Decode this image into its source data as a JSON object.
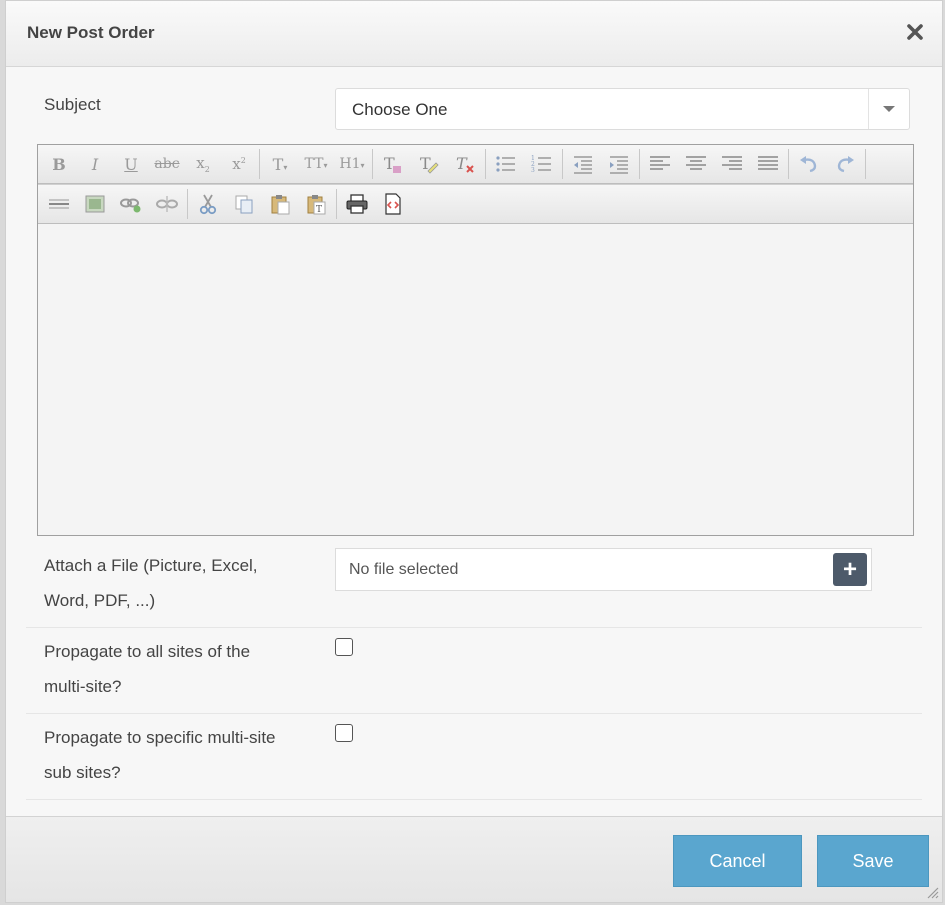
{
  "dialog": {
    "title": "New Post Order",
    "close_icon": "close-icon"
  },
  "form": {
    "subject_label": "Subject",
    "subject_value": "Choose One",
    "attach_label_line1": "Attach a File (Picture, Excel,",
    "attach_label_line2": "Word, PDF, ...)",
    "file_placeholder": "No file selected",
    "file_add_symbol": "+",
    "propagate_all_line1": "Propagate to all sites of the",
    "propagate_all_line2": "multi-site?",
    "propagate_specific_line1": "Propagate to specific multi-site",
    "propagate_specific_line2": "sub sites?",
    "propagate_all_checked": false,
    "propagate_specific_checked": false
  },
  "toolbar": {
    "row1": [
      {
        "name": "bold-button",
        "glyph": "B"
      },
      {
        "name": "italic-button",
        "glyph": "I"
      },
      {
        "name": "underline-button",
        "glyph": "U"
      },
      {
        "name": "strikethrough-button",
        "glyph": "abc"
      },
      {
        "name": "subscript-button",
        "glyph": "x₂"
      },
      {
        "name": "superscript-button",
        "glyph": "x²"
      },
      {
        "name": "font-name-button",
        "glyph": "T▾"
      },
      {
        "name": "font-size-button",
        "glyph": "TT▾"
      },
      {
        "name": "heading-button",
        "glyph": "H1▾"
      },
      {
        "name": "text-color-button",
        "glyph": "T"
      },
      {
        "name": "highlight-button",
        "glyph": "T"
      },
      {
        "name": "clear-format-button",
        "glyph": "T"
      },
      {
        "name": "bullet-list-button",
        "glyph": ""
      },
      {
        "name": "numbered-list-button",
        "glyph": ""
      },
      {
        "name": "outdent-button",
        "glyph": ""
      },
      {
        "name": "indent-button",
        "glyph": ""
      },
      {
        "name": "align-left-button",
        "glyph": ""
      },
      {
        "name": "align-center-button",
        "glyph": ""
      },
      {
        "name": "align-right-button",
        "glyph": ""
      },
      {
        "name": "align-justify-button",
        "glyph": ""
      },
      {
        "name": "undo-button",
        "glyph": ""
      },
      {
        "name": "redo-button",
        "glyph": ""
      }
    ]
  },
  "footer": {
    "cancel_label": "Cancel",
    "save_label": "Save"
  },
  "colors": {
    "button_blue": "#5aa6cf",
    "add_button": "#4d5a6a"
  }
}
